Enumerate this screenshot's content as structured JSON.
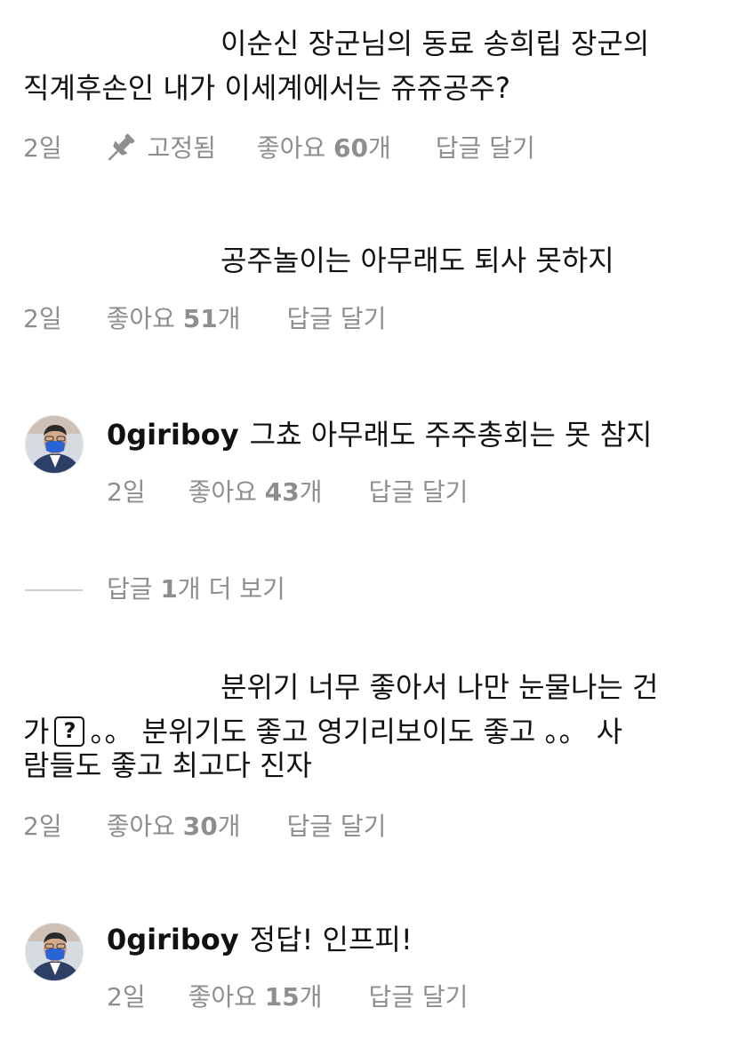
{
  "comments": [
    {
      "line1": "이순신 장군님의 동료 송희립 장군의",
      "line2": "직계후손인 내가 이세계에서는 쥬쥬공주?",
      "time": "2일",
      "pinned_label": "고정됨",
      "likes_prefix": "좋아요 ",
      "likes_count": "60",
      "likes_suffix": "개",
      "reply_label": "답글 달기"
    },
    {
      "line1": "공주놀이는 아무래도 퇴사 못하지",
      "time": "2일",
      "likes_prefix": "좋아요 ",
      "likes_count": "51",
      "likes_suffix": "개",
      "reply_label": "답글 달기"
    },
    {
      "username": "0giriboy",
      "text": "그쵸 아무래도 주주총회는 못 참지",
      "time": "2일",
      "likes_prefix": "좋아요 ",
      "likes_count": "43",
      "likes_suffix": "개",
      "reply_label": "답글 달기"
    },
    {
      "line1": "분위기 너무 좋아서 나만 눈물나는 건",
      "line2_start": "가",
      "line2_icon": "?",
      "line2_end": "。。 분위기도 좋고 영기리보이도 좋고 。。 사",
      "line3": "람들도 좋고 최고다 진자",
      "time": "2일",
      "likes_prefix": "좋아요 ",
      "likes_count": "30",
      "likes_suffix": "개",
      "reply_label": "답글 달기"
    },
    {
      "username": "0giriboy",
      "text": "정답! 인프피!",
      "time": "2일",
      "likes_prefix": "좋아요 ",
      "likes_count": "15",
      "likes_suffix": "개",
      "reply_label": "답글 달기"
    }
  ],
  "view_more": {
    "prefix": "답글 ",
    "count": "1",
    "suffix": "개 더 보기"
  },
  "icons": {
    "pin": "pin-icon",
    "question": "question-box-icon"
  },
  "colors": {
    "text": "#111111",
    "meta": "#8e8e8e"
  }
}
